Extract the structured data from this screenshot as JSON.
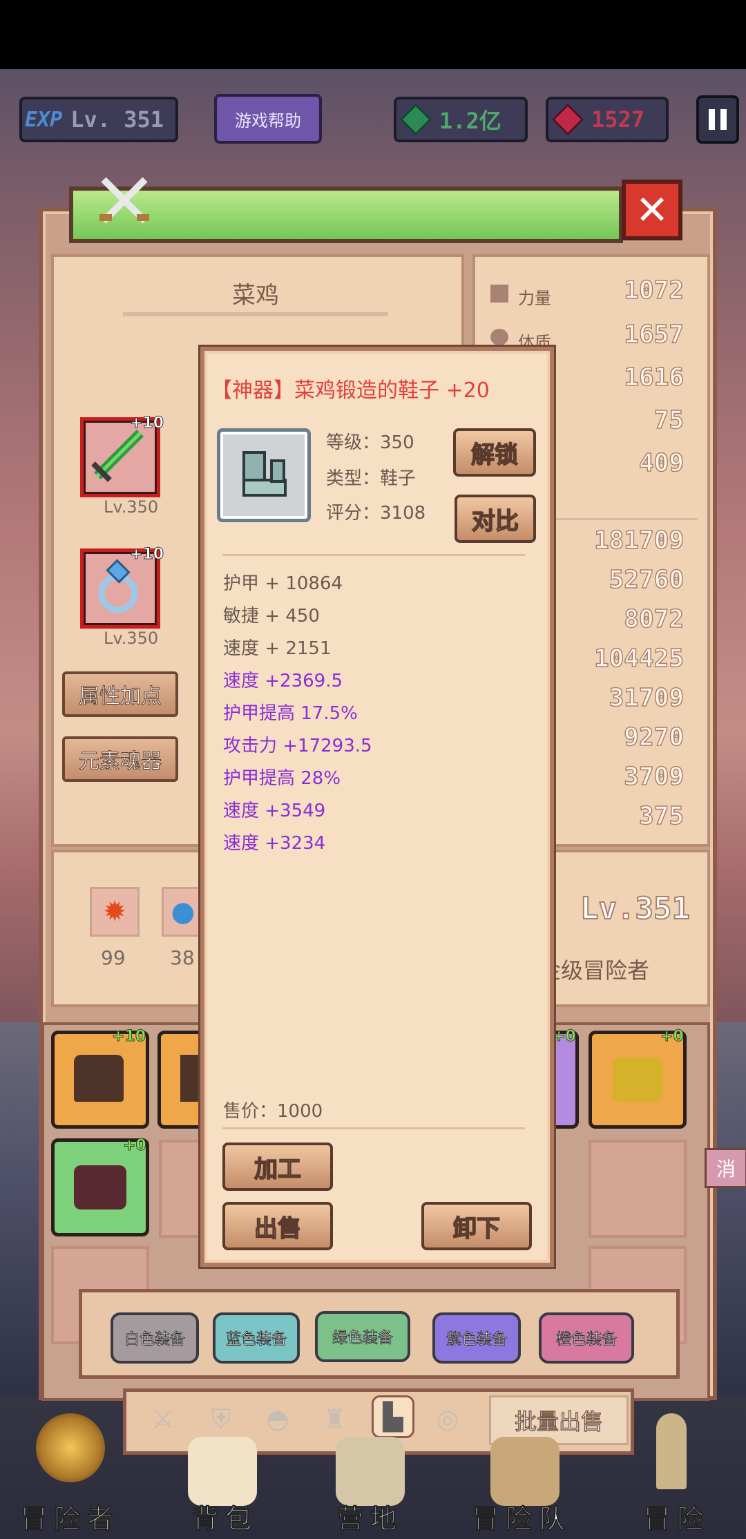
{
  "topbar": {
    "exp_icon": "EXP",
    "level": "Lv. 351",
    "help_label": "游戏帮助",
    "gems": "1.2亿",
    "rubies": "1527"
  },
  "character": {
    "name": "菜鸡",
    "weapon_plus": "+10",
    "weapon_level": "Lv.350",
    "ring_plus": "+10",
    "ring_level": "Lv.350",
    "attr_btn": "属性加点",
    "soul_btn": "元素魂器",
    "level_badge": "Lv.351",
    "rank_title": "金级冒险者",
    "element_counts": [
      "99",
      "38"
    ]
  },
  "stats": [
    {
      "label": "力量",
      "value": "1072"
    },
    {
      "label": "体质",
      "value": "1657"
    },
    {
      "label": "",
      "value": "1616"
    },
    {
      "label": "",
      "value": "75"
    },
    {
      "label": "",
      "value": "409"
    },
    {
      "label": "",
      "value": "181709"
    },
    {
      "label": "",
      "value": "52760"
    },
    {
      "label": "",
      "value": "8072"
    },
    {
      "label": "",
      "value": "104425"
    },
    {
      "label": "",
      "value": "31709"
    },
    {
      "label": "",
      "value": "9270"
    },
    {
      "label": "",
      "value": "3709"
    },
    {
      "label": "",
      "value": "375"
    }
  ],
  "popup": {
    "title": "【神器】菜鸡锻造的鞋子 +20",
    "level": "等级：350",
    "type": "类型：鞋子",
    "score": "评分：3108",
    "unlock_btn": "解锁",
    "compare_btn": "对比",
    "base_attrs": [
      "护甲 + 10864",
      "敏捷 + 450",
      "速度 + 2151"
    ],
    "bonus_attrs": [
      "速度 +2369.5",
      "护甲提高 17.5%",
      "攻击力 +17293.5",
      "护甲提高 28%",
      "速度 +3549",
      "速度 +3234"
    ],
    "price": "售价：1000",
    "process_btn": "加工",
    "sell_btn": "出售",
    "unequip_btn": "卸下"
  },
  "inventory": {
    "plus_labels": [
      "+10",
      "+0",
      "+0",
      "+0"
    ],
    "filters": [
      "白色装备",
      "蓝色装备",
      "绿色装备",
      "紫色装备",
      "橙色装备"
    ],
    "batch_sell": "批量出售",
    "side_cancel": "消"
  },
  "nav": [
    "冒险者",
    "背包",
    "营地",
    "冒险队",
    "冒险"
  ],
  "colors": {
    "legendary": "#e0403a",
    "bonus": "#8a2fd6",
    "panel": "#f7dfc3"
  }
}
